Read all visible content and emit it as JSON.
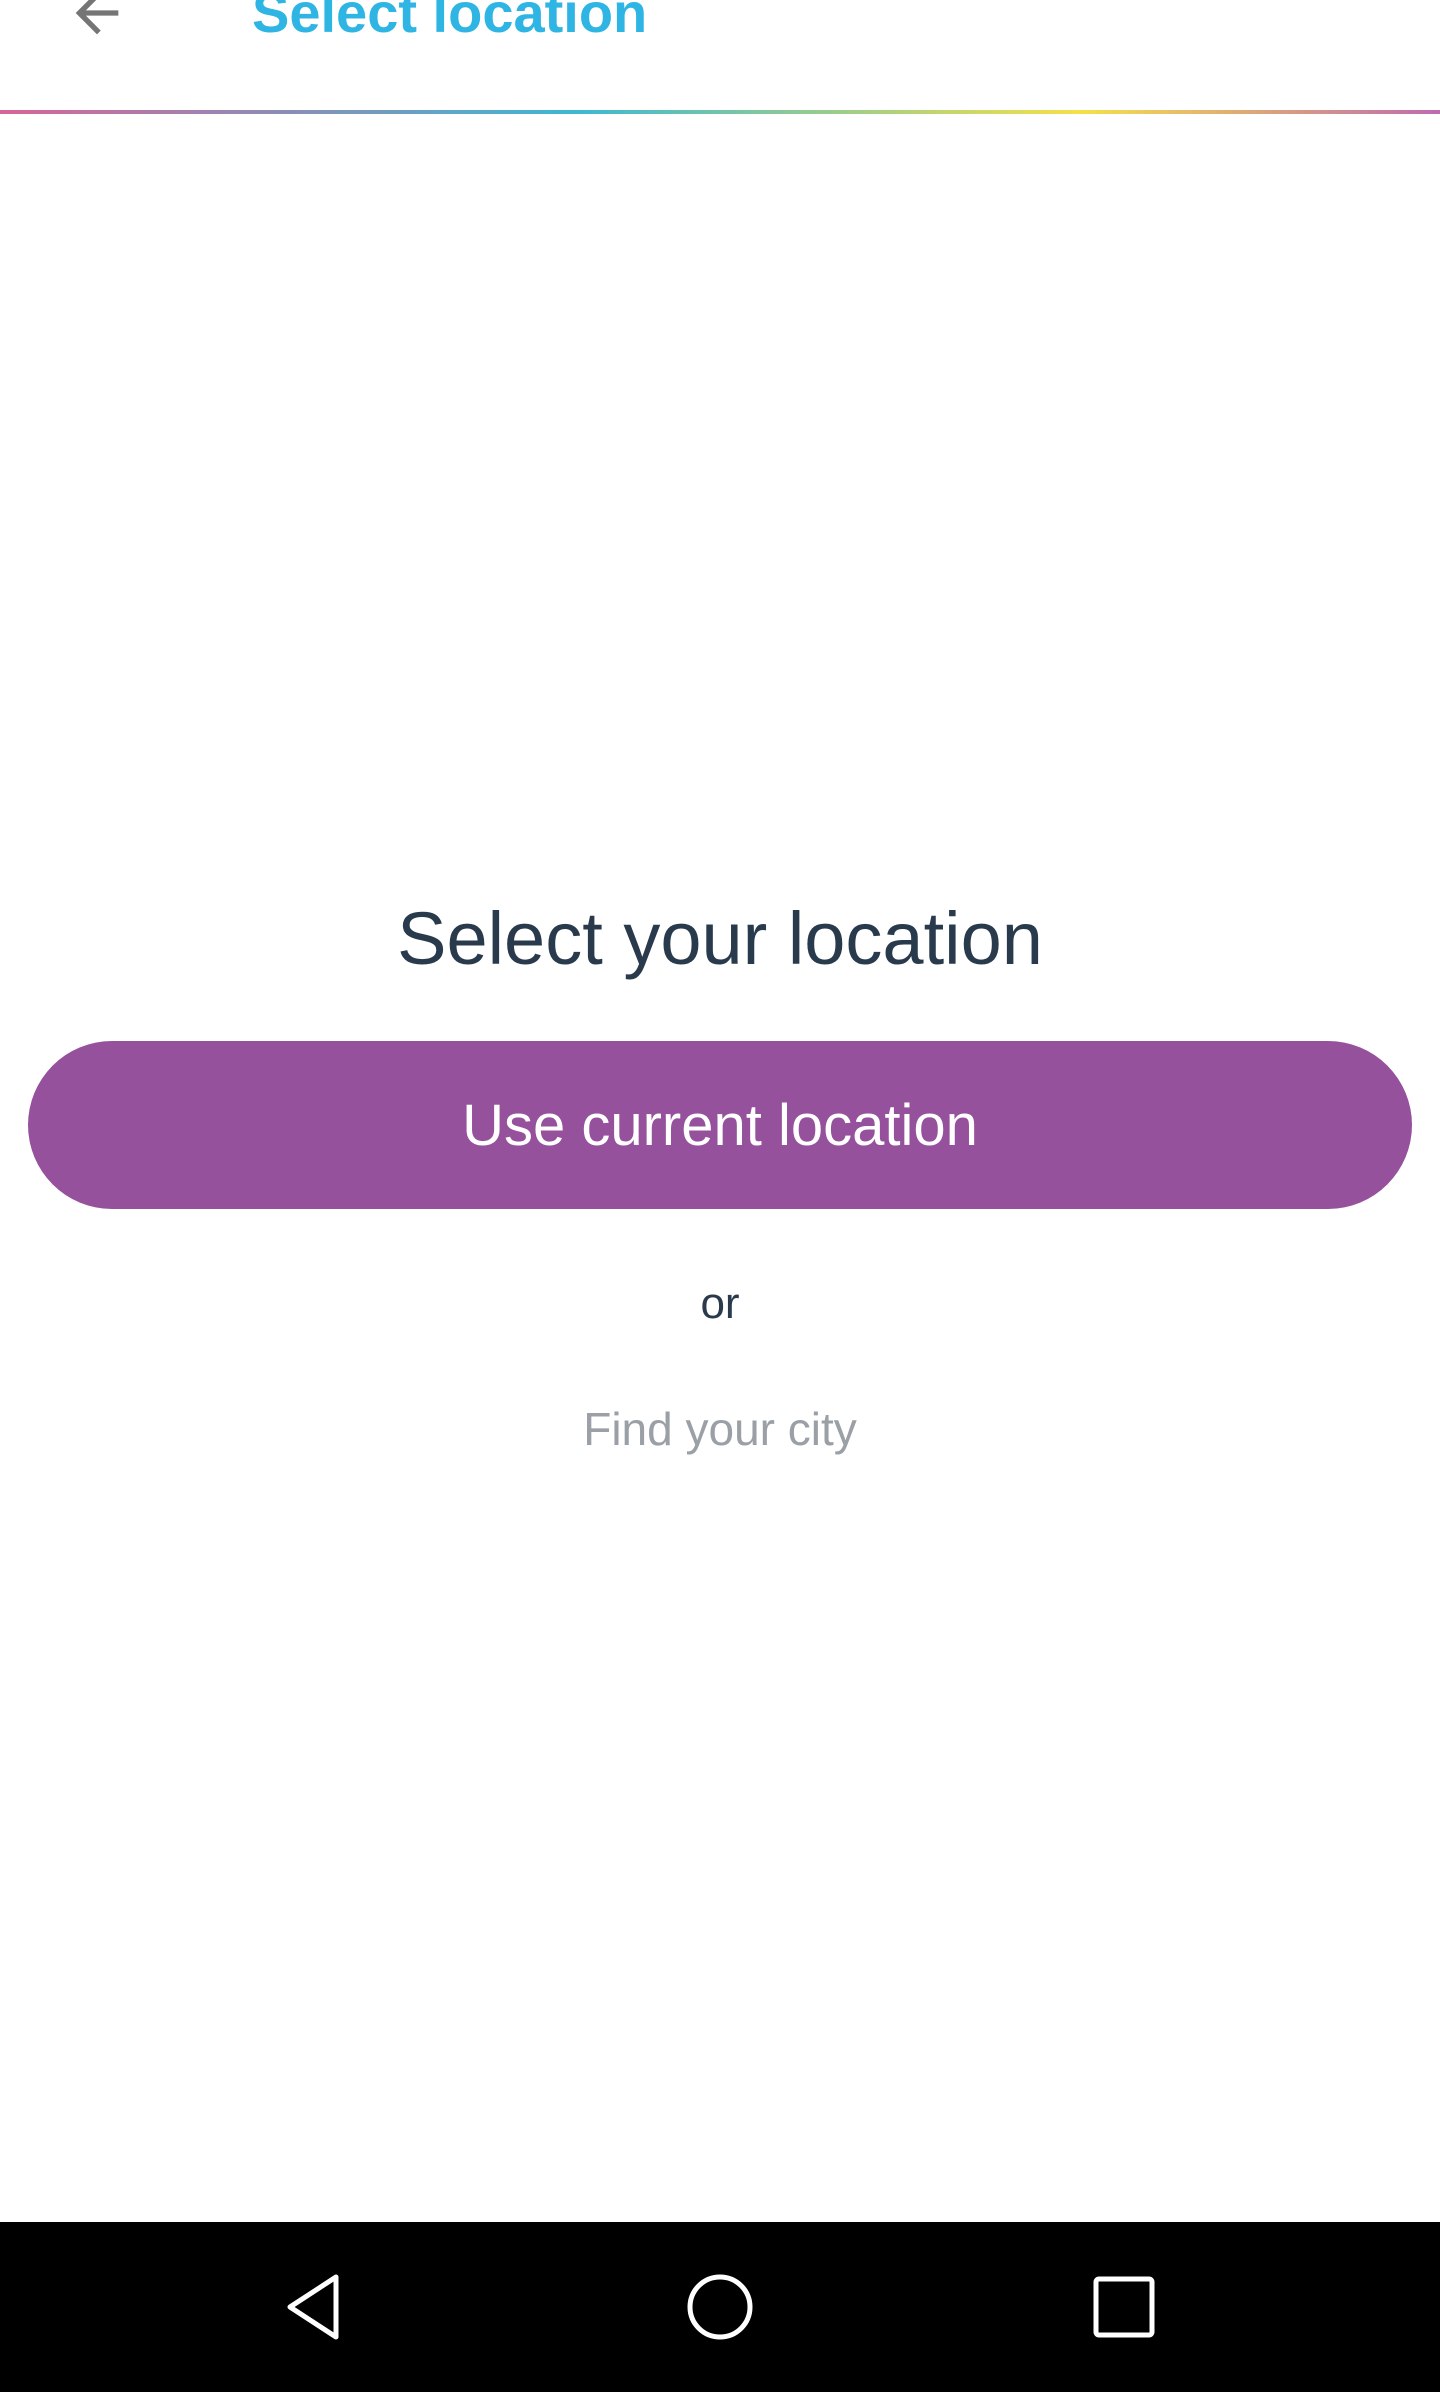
{
  "app_bar": {
    "title": "Select location",
    "back_icon": "arrow-left-icon"
  },
  "main": {
    "heading": "Select your location",
    "use_current_location_label": "Use current location",
    "or_label": "or",
    "find_city_label": "Find your city"
  },
  "nav_bar": {
    "back_icon": "nav-back-icon",
    "home_icon": "nav-home-icon",
    "recents_icon": "nav-recents-icon"
  },
  "colors": {
    "title": "#2fb5e3",
    "heading": "#2a3a4d",
    "primary_button": "#96519d",
    "find_city": "#9aa0a6",
    "divider_gradient": [
      "#d8649a",
      "#3db8d2",
      "#f5e04a",
      "#c06ab0"
    ],
    "nav_bar": "#000000"
  }
}
